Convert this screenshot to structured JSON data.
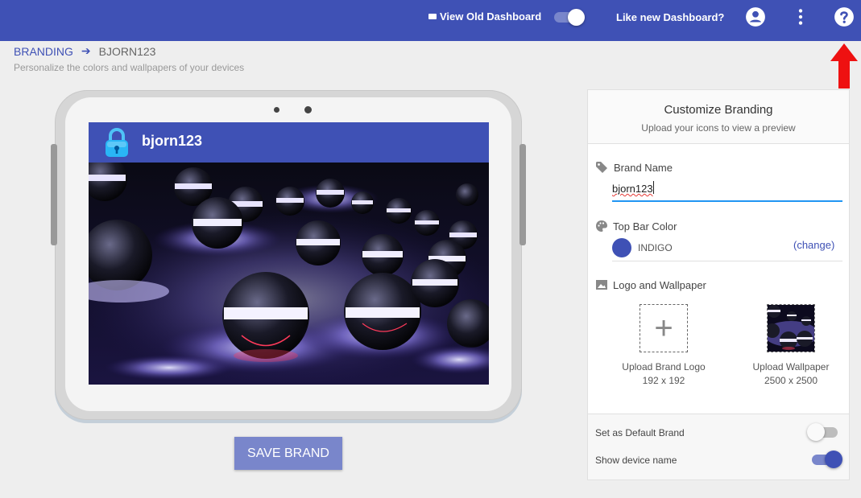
{
  "topbar": {
    "old_dashboard_label": "View Old Dashboard",
    "old_dashboard_toggle_on": true,
    "like_new_label": "Like new Dashboard?",
    "bg_color": "#3f51b5",
    "icons": [
      "account-icon",
      "more-vert-icon",
      "help-icon"
    ]
  },
  "breadcrumb": {
    "root": "BRANDING",
    "current": "BJORN123"
  },
  "page_subtitle": "Personalize the colors and wallpapers of your devices",
  "preview": {
    "screen_title": "bjorn123",
    "logo_icon": "lock-icon"
  },
  "save_button": "SAVE BRAND",
  "panel": {
    "title": "Customize Branding",
    "subtitle": "Upload your icons to view a preview",
    "brand_name": {
      "label": "Brand Name",
      "value": "bjorn123",
      "icon": "tag-icon"
    },
    "top_bar_color": {
      "label": "Top Bar Color",
      "color_name": "INDIGO",
      "color_hex": "#3f51b5",
      "change_label": "(change)",
      "icon": "palette-icon"
    },
    "logo_wallpaper": {
      "label": "Logo and Wallpaper",
      "icon": "image-icon",
      "logo_upload_label": "Upload Brand Logo",
      "logo_size": "192 x 192",
      "wallpaper_upload_label": "Upload Wallpaper",
      "wallpaper_size": "2500 x 2500"
    },
    "default_brand": {
      "label": "Set as Default Brand",
      "on": false
    },
    "show_device_name": {
      "label": "Show device name",
      "on": true
    }
  }
}
